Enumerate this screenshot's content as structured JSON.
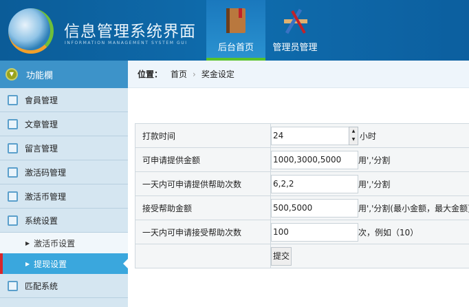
{
  "header": {
    "title": "信息管理系统界面",
    "subtitle": "INFORMATION MANAGEMENT SYSTEM GUI",
    "tabs": [
      {
        "label": "后台首页",
        "active": true
      },
      {
        "label": "管理员管理",
        "active": false
      }
    ]
  },
  "sidebar": {
    "title": "功能欄",
    "items": [
      {
        "label": "會員管理"
      },
      {
        "label": "文章管理"
      },
      {
        "label": "留言管理"
      },
      {
        "label": "激活码管理"
      },
      {
        "label": "激活币管理"
      },
      {
        "label": "系统设置"
      }
    ],
    "subitems": [
      {
        "label": "激活币设置"
      },
      {
        "label": "提现设置"
      }
    ],
    "last": {
      "label": "匹配系统"
    }
  },
  "breadcrumb": {
    "prefix": "位置：",
    "home": "首页",
    "current": "奖金设定"
  },
  "form": {
    "rows": [
      {
        "label": "打款时间",
        "value": "24",
        "note": "小时"
      },
      {
        "label": "可申请提供金额",
        "value": "1000,3000,5000",
        "note": "用','分割"
      },
      {
        "label": "一天内可申请提供帮助次数",
        "value": "6,2,2",
        "note": "用','分割"
      },
      {
        "label": "接受帮助金额",
        "value": "500,5000",
        "note": "用','分割(最小金额，最大金额)"
      },
      {
        "label": "一天内可申请接受帮助次数",
        "value": "100",
        "note": "次，例如（10）"
      }
    ],
    "submit": "提交"
  }
}
